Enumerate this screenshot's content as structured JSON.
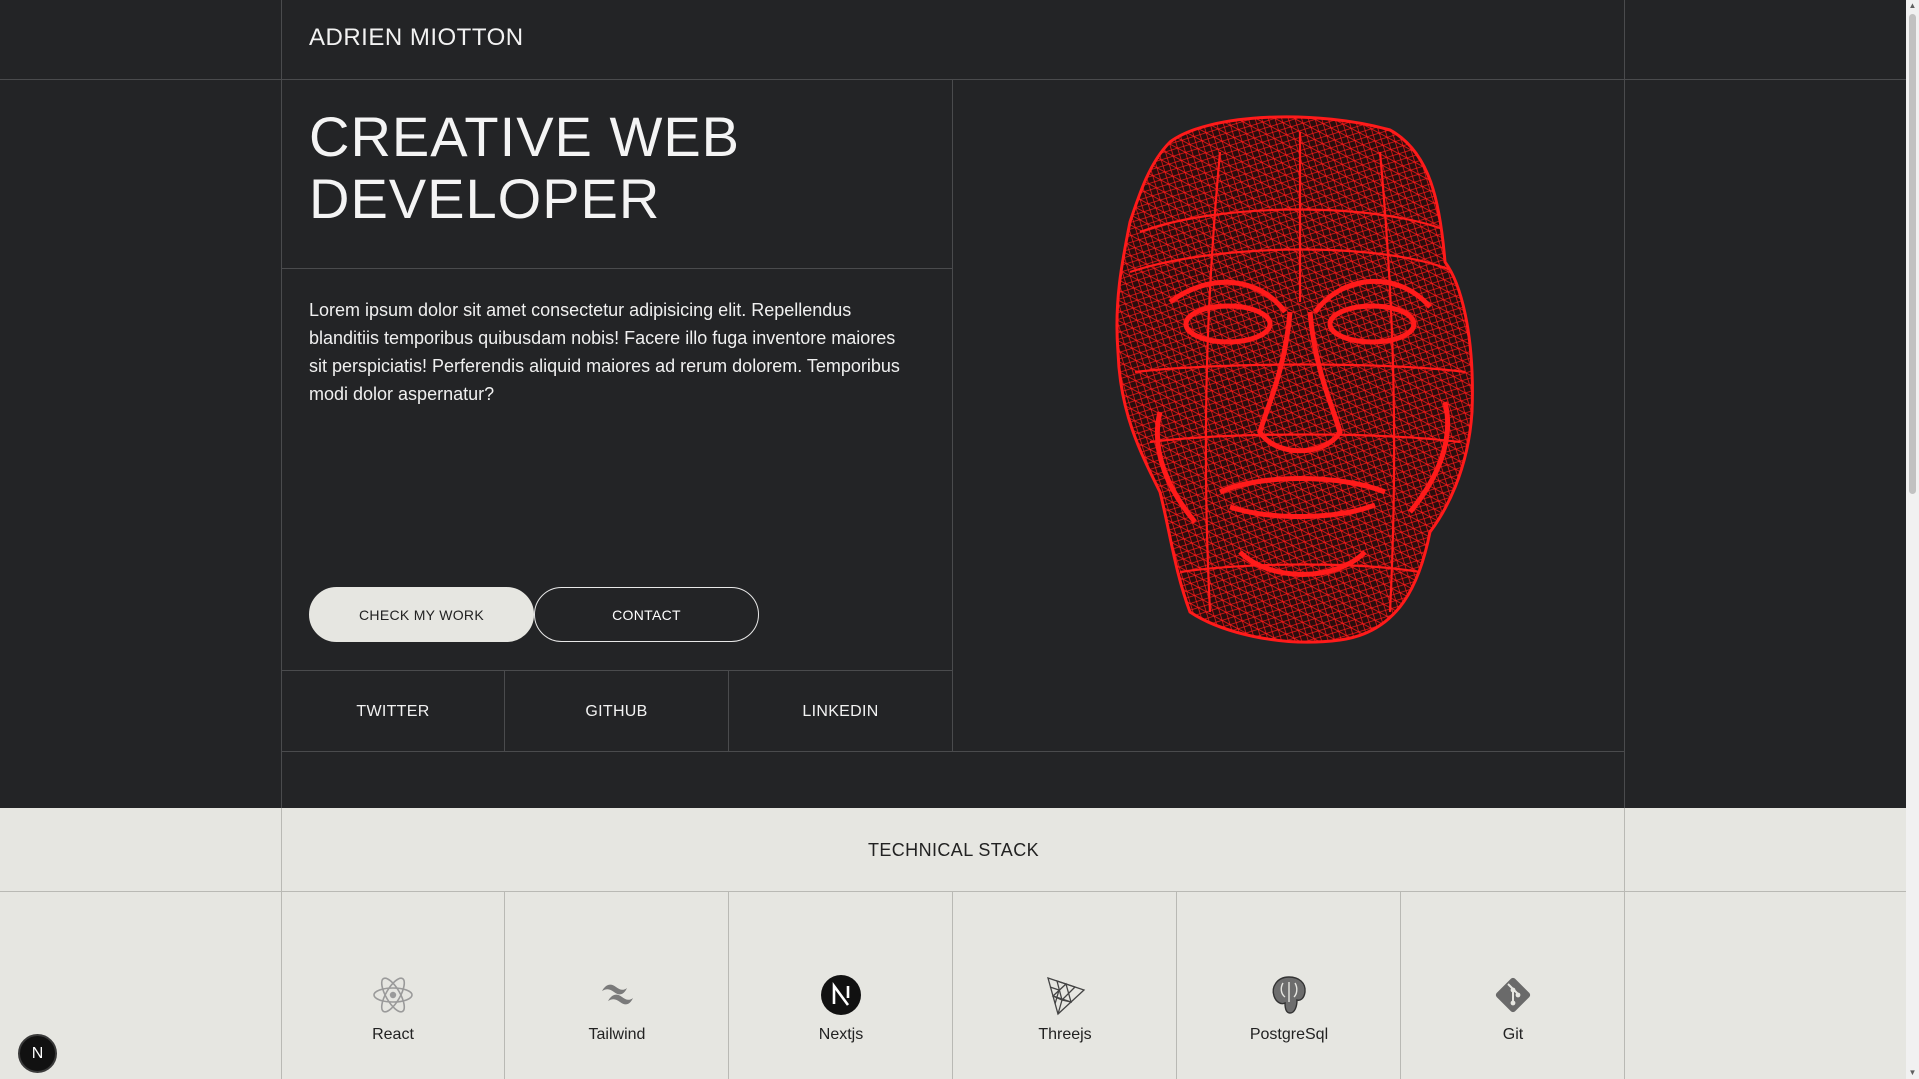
{
  "header": {
    "brand": "ADRIEN MIOTTON"
  },
  "hero": {
    "title_line1": "CREATIVE WEB",
    "title_line2": "DEVELOPER",
    "bio": "Lorem ipsum dolor sit amet consectetur adipisicing elit. Repellendus blanditiis temporibus quibusdam nobis! Facere illo fuga inventore maiores sit perspiciatis! Perferendis aliquid maiores ad rerum dolorem. Temporibus modi dolor aspernatur?",
    "buttons": {
      "primary": "CHECK MY WORK",
      "secondary": "CONTACT"
    },
    "image_icon": "wireframe-face-icon",
    "accent_color": "#ff1a1a"
  },
  "social": [
    {
      "label": "TWITTER"
    },
    {
      "label": "GITHUB"
    },
    {
      "label": "LINKEDIN"
    }
  ],
  "stack": {
    "title": "TECHNICAL STACK",
    "items": [
      {
        "label": "React",
        "icon": "react-icon"
      },
      {
        "label": "Tailwind",
        "icon": "tailwind-icon"
      },
      {
        "label": "Nextjs",
        "icon": "nextjs-icon"
      },
      {
        "label": "Threejs",
        "icon": "threejs-icon"
      },
      {
        "label": "PostgreSql",
        "icon": "postgresql-icon"
      },
      {
        "label": "Git",
        "icon": "git-icon"
      }
    ]
  },
  "badge": {
    "label": "N",
    "icon": "nextjs-badge-icon"
  },
  "colors": {
    "dark_bg": "#232426",
    "light_bg": "#e6e6e1",
    "line": "#4a4b4d"
  }
}
